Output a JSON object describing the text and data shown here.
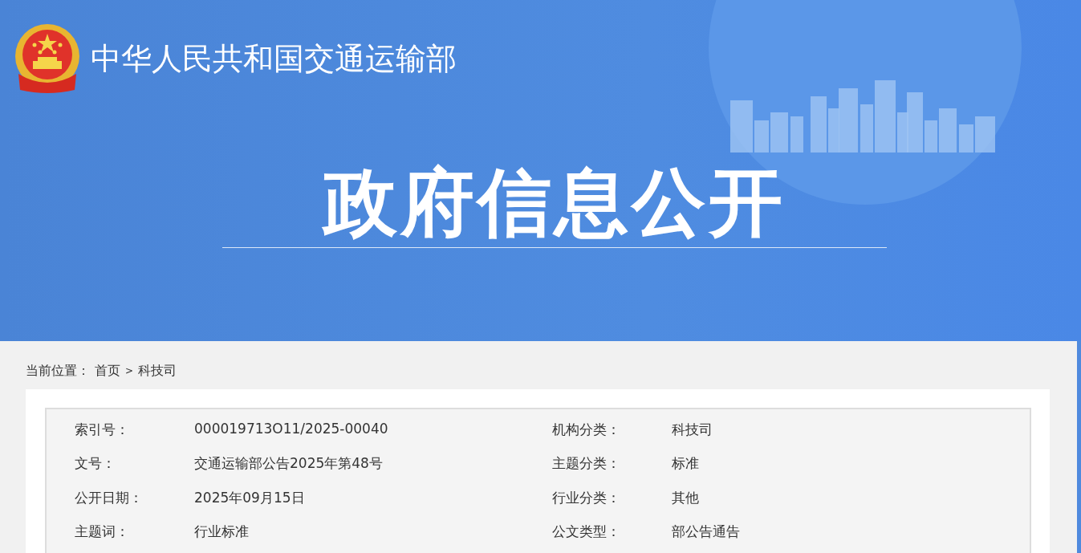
{
  "header": {
    "org_title": "中华人民共和国交通运输部",
    "banner_title": "政府信息公开"
  },
  "breadcrumb": {
    "label": "当前位置：",
    "items": [
      {
        "text": "首页"
      },
      {
        "text": "科技司"
      }
    ],
    "separator": ">"
  },
  "info_rows": [
    {
      "cells": [
        {
          "label": "索引号：",
          "value": "000019713O11/2025-00040"
        },
        {
          "label": "机构分类：",
          "value": "科技司"
        }
      ]
    },
    {
      "cells": [
        {
          "label": "文号：",
          "value": "交通运输部公告2025年第48号"
        },
        {
          "label": "主题分类：",
          "value": "标准"
        }
      ]
    },
    {
      "cells": [
        {
          "label": "公开日期：",
          "value": "2025年09月15日"
        },
        {
          "label": "行业分类：",
          "value": "其他"
        }
      ]
    },
    {
      "cells": [
        {
          "label": "主题词：",
          "value": "行业标准"
        },
        {
          "label": "公文类型：",
          "value": "部公告通告"
        }
      ]
    }
  ]
}
